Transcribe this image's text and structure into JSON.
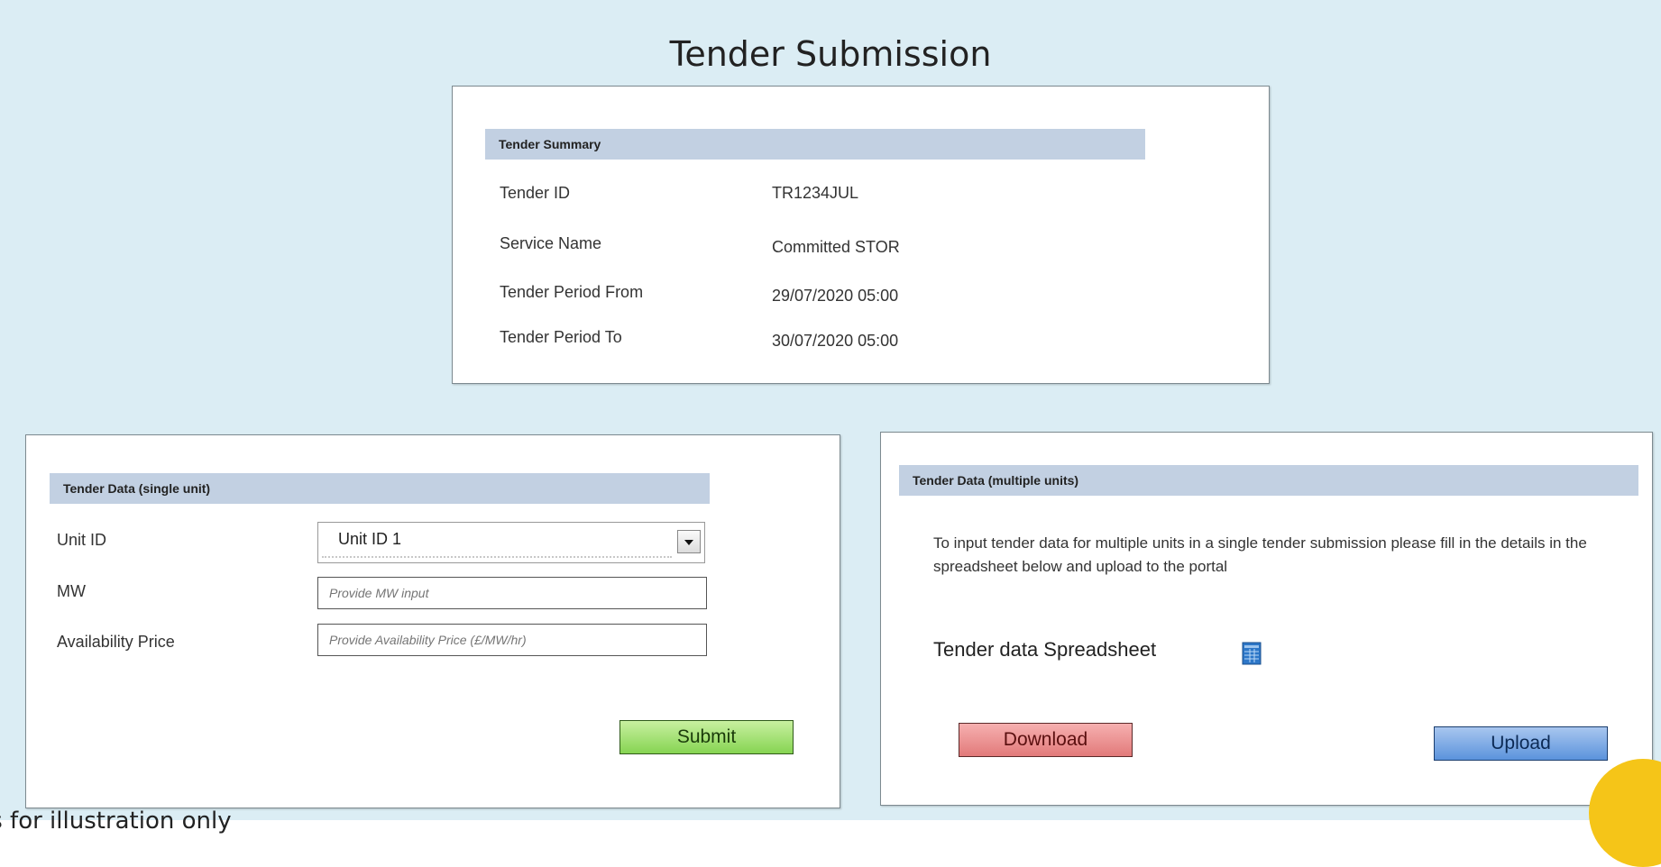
{
  "page": {
    "title": "Tender Submission"
  },
  "summary": {
    "header": "Tender Summary",
    "rows": [
      {
        "label": "Tender ID",
        "value": "TR1234JUL"
      },
      {
        "label": "Service Name",
        "value": "Committed STOR"
      },
      {
        "label": "Tender Period From",
        "value": "29/07/2020 05:00"
      },
      {
        "label": "Tender Period To",
        "value": "30/07/2020 05:00"
      }
    ]
  },
  "single_unit": {
    "header": "Tender Data (single unit)",
    "unit_id_label": "Unit ID",
    "unit_id_selected": "Unit ID 1",
    "mw_label": "MW",
    "mw_placeholder": "Provide MW input",
    "price_label": "Availability Price",
    "price_placeholder": "Provide Availability Price (£/MW/hr)",
    "submit_label": "Submit"
  },
  "multi_unit": {
    "header": "Tender Data (multiple units)",
    "instructions": "To input tender data for multiple units in a single tender submission please fill in the details in the spreadsheet below and upload to the portal",
    "spreadsheet_label": "Tender data Spreadsheet",
    "spreadsheet_icon": "spreadsheet-icon",
    "download_label": "Download",
    "upload_label": "Upload"
  },
  "footer": {
    "text": "is for illustration only"
  },
  "colors": {
    "background": "#dbedf4",
    "section_header": "#c2d0e2",
    "submit": "#86d452",
    "download": "#e27a7a",
    "upload": "#5b93dc",
    "badge": "#f5c518"
  }
}
